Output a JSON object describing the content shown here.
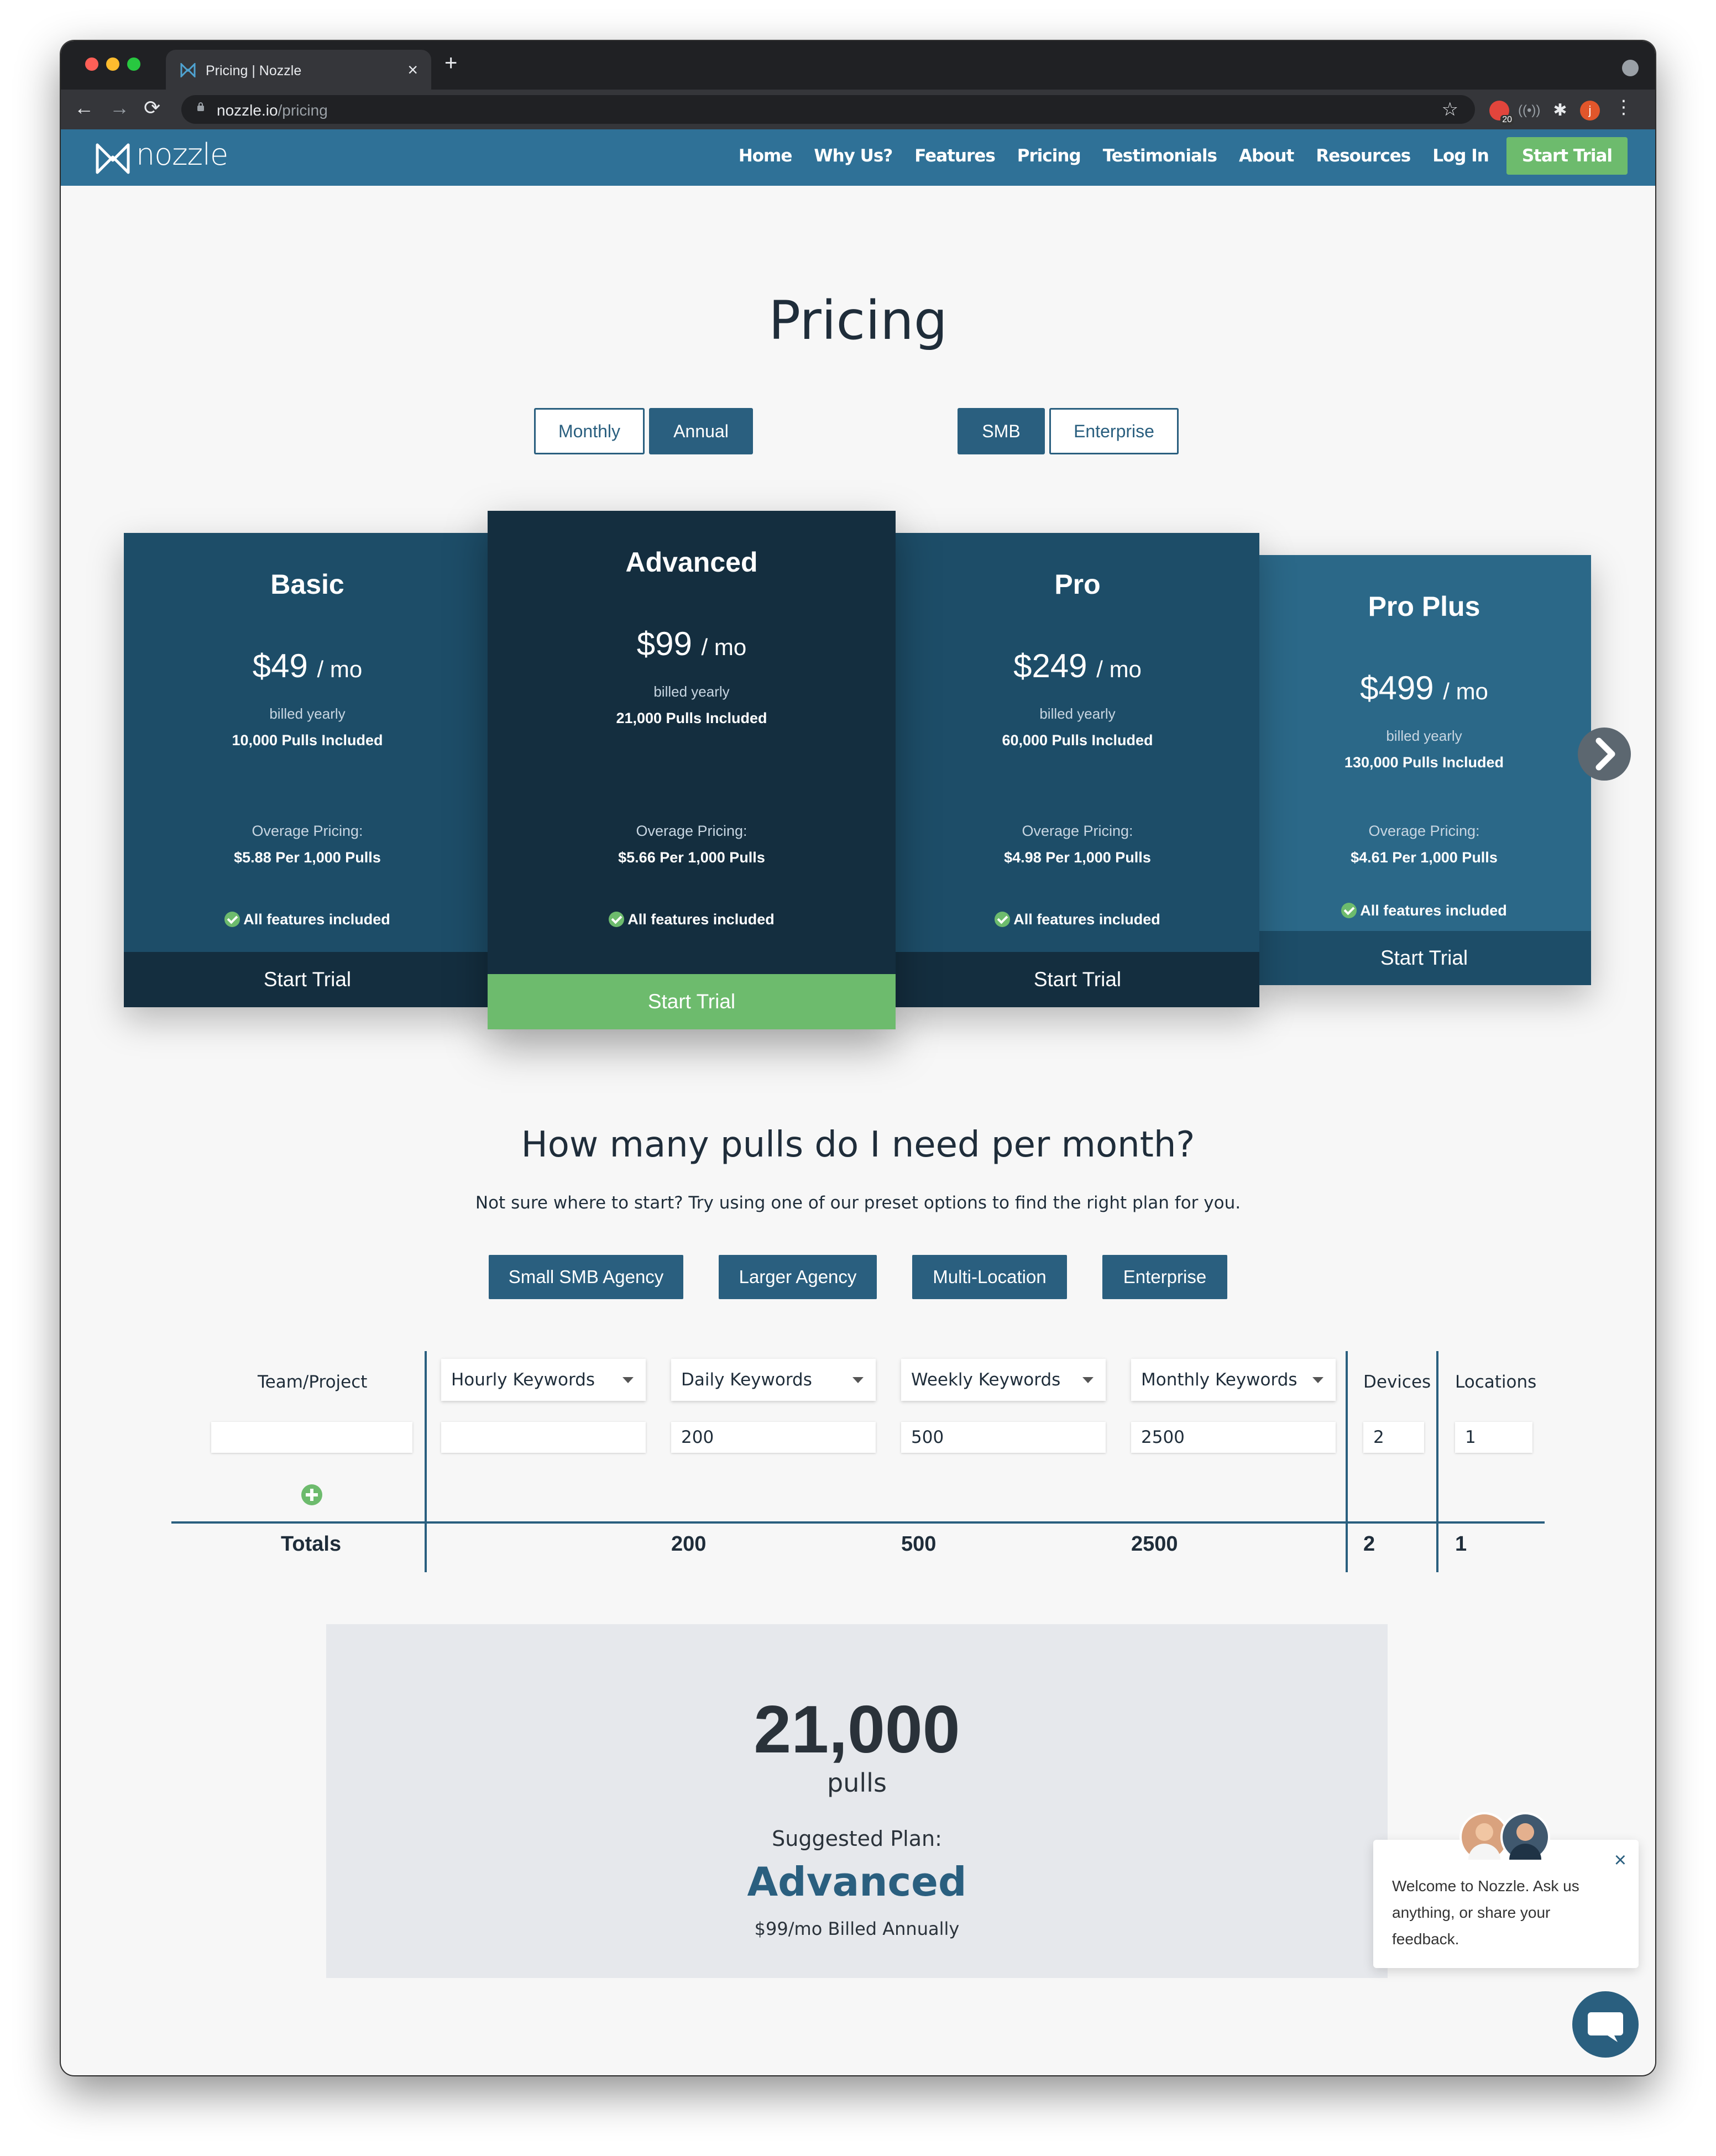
{
  "browser": {
    "tab_title": "Pricing | Nozzle",
    "tab_close": "×",
    "new_tab": "+",
    "url_host": "nozzle.io",
    "url_path": "/pricing",
    "ext_badge": "20",
    "profile_initial": "j"
  },
  "site": {
    "logo_text": "nozzle",
    "nav": [
      "Home",
      "Why Us?",
      "Features",
      "Pricing",
      "Testimonials",
      "About",
      "Resources",
      "Log In"
    ],
    "nav_cta": "Start Trial"
  },
  "pricing": {
    "heading": "Pricing",
    "billing_toggle": {
      "monthly": "Monthly",
      "annual": "Annual",
      "selected": "Annual"
    },
    "segment_toggle": {
      "smb": "SMB",
      "enterprise": "Enterprise",
      "selected": "SMB"
    },
    "plans": [
      {
        "name": "Basic",
        "price": "$49",
        "per": "/ mo",
        "billed": "billed yearly",
        "pulls": "10,000 Pulls Included",
        "overage_label": "Overage Pricing:",
        "overage": "$5.88 Per 1,000 Pulls",
        "features": "All features included",
        "cta": "Start Trial"
      },
      {
        "name": "Advanced",
        "price": "$99",
        "per": "/ mo",
        "billed": "billed yearly",
        "pulls": "21,000 Pulls Included",
        "overage_label": "Overage Pricing:",
        "overage": "$5.66 Per 1,000 Pulls",
        "features": "All features included",
        "cta": "Start Trial"
      },
      {
        "name": "Pro",
        "price": "$249",
        "per": "/ mo",
        "billed": "billed yearly",
        "pulls": "60,000 Pulls Included",
        "overage_label": "Overage Pricing:",
        "overage": "$4.98 Per 1,000 Pulls",
        "features": "All features included",
        "cta": "Start Trial"
      },
      {
        "name": "Pro Plus",
        "price": "$499",
        "per": "/ mo",
        "billed": "billed yearly",
        "pulls": "130,000 Pulls Included",
        "overage_label": "Overage Pricing:",
        "overage": "$4.61 Per 1,000 Pulls",
        "features": "All features included",
        "cta": "Start Trial"
      }
    ]
  },
  "calculator": {
    "heading": "How many pulls do I need per month?",
    "subheading": "Not sure where to start? Try using one of our preset options to find the right plan for you.",
    "presets": [
      "Small SMB Agency",
      "Larger Agency",
      "Multi-Location",
      "Enterprise"
    ],
    "columns": {
      "team": "Team/Project",
      "hourly": "Hourly Keywords",
      "daily": "Daily Keywords",
      "weekly": "Weekly Keywords",
      "monthly": "Monthly Keywords",
      "devices": "Devices",
      "locations": "Locations"
    },
    "row": {
      "team": "",
      "hourly": "",
      "daily": "200",
      "weekly": "500",
      "monthly": "2500",
      "devices": "2",
      "locations": "1"
    },
    "totals": {
      "label": "Totals",
      "daily": "200",
      "weekly": "500",
      "monthly": "2500",
      "devices": "2",
      "locations": "1"
    }
  },
  "result": {
    "pulls": "21,000",
    "unit": "pulls",
    "suggested_label": "Suggested Plan:",
    "plan": "Advanced",
    "billing": "$99/mo Billed Annually"
  },
  "chat": {
    "message": "Welcome to Nozzle. Ask us anything, or share your feedback.",
    "close": "×"
  },
  "colors": {
    "nav_bg": "#2f7197",
    "primary": "#2a5f7f",
    "green": "#6dbb6d",
    "card_basic": "#1d4d68",
    "card_advanced": "#142e3f",
    "card_pro": "#1d4d68",
    "card_proplus": "#2b6888"
  }
}
